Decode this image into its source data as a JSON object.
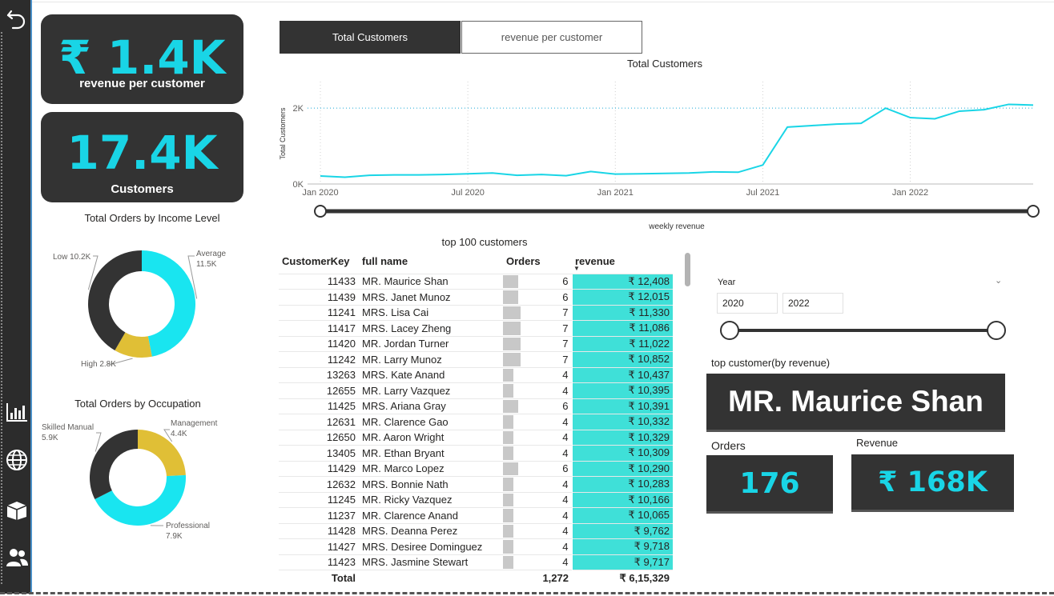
{
  "kpis": {
    "revenue_per_customer": {
      "value": "₹ 1.4K",
      "label": "revenue per customer"
    },
    "customers": {
      "value": "17.4K",
      "label": "Customers"
    }
  },
  "tabs": [
    {
      "label": "Total Customers",
      "active": true
    },
    {
      "label": "revenue per customer",
      "active": false
    }
  ],
  "line_chart_title": "Total Customers",
  "slider_label": "weekly revenue",
  "income_chart": {
    "title": "Total Orders by Income Level"
  },
  "occupation_chart": {
    "title": "Total Orders by Occupation"
  },
  "chart_data": [
    {
      "type": "line",
      "title": "Total Customers",
      "ylabel": "Total Customers",
      "xlabel": "",
      "x_ticks": [
        "Jan 2020",
        "Jul 2020",
        "Jan 2021",
        "Jul 2021",
        "Jan 2022"
      ],
      "y_ticks": [
        "0K",
        "2K"
      ],
      "ylim": [
        0,
        2700
      ],
      "x": [
        "2020-01",
        "2020-02",
        "2020-03",
        "2020-04",
        "2020-05",
        "2020-06",
        "2020-07",
        "2020-08",
        "2020-09",
        "2020-10",
        "2020-11",
        "2020-12",
        "2021-01",
        "2021-02",
        "2021-03",
        "2021-04",
        "2021-05",
        "2021-06",
        "2021-07",
        "2021-08",
        "2021-09",
        "2021-10",
        "2021-11",
        "2021-12",
        "2022-01",
        "2022-02",
        "2022-03",
        "2022-04",
        "2022-05",
        "2022-06"
      ],
      "series": [
        {
          "values": [
            210,
            180,
            230,
            240,
            240,
            250,
            270,
            290,
            230,
            250,
            220,
            330,
            260,
            270,
            280,
            290,
            320,
            310,
            500,
            1500,
            1540,
            1580,
            1600,
            2000,
            1750,
            1720,
            1920,
            1960,
            2100,
            2080
          ]
        }
      ],
      "color": "#19d5e6"
    },
    {
      "type": "pie",
      "title": "Total Orders by Income Level",
      "donut": true,
      "slices": [
        {
          "label": "Average",
          "value": 11.5,
          "display": "11.5K",
          "color": "#19e5f0"
        },
        {
          "label": "High",
          "value": 2.8,
          "display": "2.8K",
          "color": "#e0bf36"
        },
        {
          "label": "Low",
          "value": 10.2,
          "display": "10.2K",
          "color": "#333333"
        }
      ]
    },
    {
      "type": "pie",
      "title": "Total Orders by Occupation",
      "donut": true,
      "slices": [
        {
          "label": "Management",
          "value": 4.4,
          "display": "4.4K",
          "color": "#e0bf36"
        },
        {
          "label": "Professional",
          "value": 7.9,
          "display": "7.9K",
          "color": "#19e5f0"
        },
        {
          "label": "Skilled Manual",
          "value": 5.9,
          "display": "5.9K",
          "color": "#333333"
        }
      ]
    }
  ],
  "table": {
    "title": "top 100 customers",
    "headers": [
      "CustomerKey",
      "full name",
      "Orders",
      "revenue"
    ],
    "rows": [
      {
        "key": "11433",
        "name": "MR. Maurice Shan",
        "orders": 6,
        "revenue": "₹ 12,408"
      },
      {
        "key": "11439",
        "name": "MRS. Janet Munoz",
        "orders": 6,
        "revenue": "₹ 12,015"
      },
      {
        "key": "11241",
        "name": "MRS. Lisa Cai",
        "orders": 7,
        "revenue": "₹ 11,330"
      },
      {
        "key": "11417",
        "name": "MRS. Lacey Zheng",
        "orders": 7,
        "revenue": "₹ 11,086"
      },
      {
        "key": "11420",
        "name": "MR. Jordan Turner",
        "orders": 7,
        "revenue": "₹ 11,022"
      },
      {
        "key": "11242",
        "name": "MR. Larry Munoz",
        "orders": 7,
        "revenue": "₹ 10,852"
      },
      {
        "key": "13263",
        "name": "MRS. Kate Anand",
        "orders": 4,
        "revenue": "₹ 10,437"
      },
      {
        "key": "12655",
        "name": "MR. Larry Vazquez",
        "orders": 4,
        "revenue": "₹ 10,395"
      },
      {
        "key": "11425",
        "name": "MRS. Ariana Gray",
        "orders": 6,
        "revenue": "₹ 10,391"
      },
      {
        "key": "12631",
        "name": "MR. Clarence Gao",
        "orders": 4,
        "revenue": "₹ 10,332"
      },
      {
        "key": "12650",
        "name": "MR. Aaron Wright",
        "orders": 4,
        "revenue": "₹ 10,329"
      },
      {
        "key": "13405",
        "name": "MR. Ethan Bryant",
        "orders": 4,
        "revenue": "₹ 10,309"
      },
      {
        "key": "11429",
        "name": "MR. Marco Lopez",
        "orders": 6,
        "revenue": "₹ 10,290"
      },
      {
        "key": "12632",
        "name": "MRS. Bonnie Nath",
        "orders": 4,
        "revenue": "₹ 10,283"
      },
      {
        "key": "11245",
        "name": "MR. Ricky Vazquez",
        "orders": 4,
        "revenue": "₹ 10,166"
      },
      {
        "key": "11237",
        "name": "MR. Clarence Anand",
        "orders": 4,
        "revenue": "₹ 10,065"
      },
      {
        "key": "11428",
        "name": "MRS. Deanna Perez",
        "orders": 4,
        "revenue": "₹ 9,762"
      },
      {
        "key": "11427",
        "name": "MRS. Desiree Dominguez",
        "orders": 4,
        "revenue": "₹ 9,718"
      },
      {
        "key": "11423",
        "name": "MRS. Jasmine Stewart",
        "orders": 4,
        "revenue": "₹ 9,717"
      }
    ],
    "total": {
      "label": "Total",
      "orders": "1,272",
      "revenue": "₹ 6,15,329"
    }
  },
  "year_slicer": {
    "label": "Year",
    "from": "2020",
    "to": "2022"
  },
  "top_customer": {
    "label": "top customer(by revenue)",
    "name": "MR. Maurice Shan"
  },
  "orders_card": {
    "label": "Orders",
    "value": "176"
  },
  "revenue_card": {
    "label": "Revenue",
    "value": "₹ 168K"
  },
  "colors": {
    "accent": "#19d5e6",
    "dark": "#333333",
    "gold": "#e0bf36",
    "table_highlight": "#3fe0d8"
  },
  "sidebar_icons": [
    "back-arrow-icon",
    "bar-chart-icon",
    "globe-icon",
    "box-icon",
    "users-icon"
  ]
}
